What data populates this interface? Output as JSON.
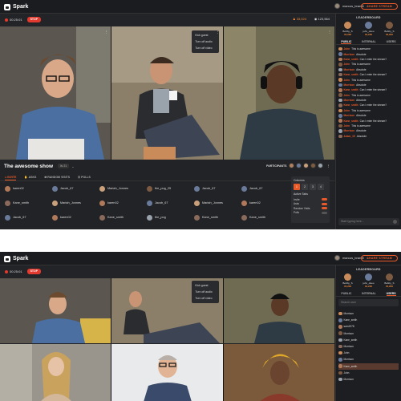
{
  "app": {
    "name": "Spark"
  },
  "topbar": {
    "username": "marcus_brandt",
    "share_label": "SHARE STREAM"
  },
  "subbar": {
    "timer": "00:25:01",
    "stop_label": "STOP",
    "viewers_orange": "33,024",
    "viewers": "123,564"
  },
  "context_menu": {
    "items": [
      "Kick guest",
      "Turn off audio",
      "Turn off video"
    ]
  },
  "show": {
    "title": "The awesome show",
    "badge": "liv 21"
  },
  "participants_label": "PARTICIPANTS",
  "tabs": [
    "INVITE",
    "ASKS",
    "RANDOM VISITS",
    "POLLS"
  ],
  "guest_grid": [
    "karen02",
    "Jacob_67",
    "Mariah_Jonnes",
    "the_pug_25",
    "Jacob_67",
    "Jacob_67",
    "Kane_smith",
    "Mariah_Jonnes",
    "karen02",
    "Jacob_67",
    "Mariah_Jonnes",
    "karen02",
    "Jacob_67",
    "karen02",
    "Kane_smith",
    "the_pog",
    "Kane_smith",
    "Kane_smith"
  ],
  "layout_popup": {
    "columns_label": "Columns",
    "columns": [
      "1",
      "2",
      "3",
      "4"
    ],
    "selected": "1",
    "active_tabs_label": "Active Tabs",
    "options": [
      {
        "label": "Invite",
        "on": true
      },
      {
        "label": "Asks",
        "on": true
      },
      {
        "label": "Random Visits",
        "on": true
      },
      {
        "label": "Polls",
        "on": false
      }
    ]
  },
  "sidebar": {
    "leaderboard_title": "LEADERBOARD",
    "leaders": [
      {
        "name": "Bobby_S",
        "value": "45,200"
      },
      {
        "name": "john_doeo",
        "value": "34,200"
      },
      {
        "name": "Bobby_S",
        "value": "45,200"
      }
    ],
    "tabs": [
      "PUBLIC",
      "INTERNAL",
      "USERS"
    ],
    "active_tab_p1": "PUBLIC",
    "active_tab_p2": "USERS",
    "chat": [
      {
        "user": "John",
        "text": "This is awesome"
      },
      {
        "user": "Morrison",
        "text": "Absolute"
      },
      {
        "user": "Kane_smith",
        "text": "Can I enter the stream?"
      },
      {
        "user": "John",
        "text": "This is awesome"
      },
      {
        "user": "Morrison",
        "text": "Absolute"
      },
      {
        "user": "Kane_smith",
        "text": "Can I enter the stream?"
      },
      {
        "user": "John",
        "text": "This is awesome"
      },
      {
        "user": "Morrison",
        "text": "Absolute"
      },
      {
        "user": "Kane_smith",
        "text": "Can I enter the stream?"
      },
      {
        "user": "John",
        "text": "This is awesome"
      },
      {
        "user": "Morrison",
        "text": "Absolute"
      },
      {
        "user": "Kane_smith",
        "text": "Can I enter the stream?"
      },
      {
        "user": "John",
        "text": "This is awesome"
      },
      {
        "user": "Morrison",
        "text": "Absolute"
      },
      {
        "user": "Kane_smith",
        "text": "Can I enter the stream?"
      },
      {
        "user": "John",
        "text": "This is awesome"
      },
      {
        "user": "Morrison",
        "text": "Absolute"
      },
      {
        "user": "Adam_15",
        "text": "Absolute"
      }
    ],
    "chat_placeholder": "Start typing here...",
    "search_placeholder": "Search user",
    "users": [
      "Morrison",
      "Kane_smith",
      "sam1978",
      "Morrison",
      "Kane_smith",
      "Morrison",
      "John",
      "Morrison",
      "Kane_smith",
      "John",
      "Morrison"
    ],
    "highlight_user_index": 8
  },
  "colors": {
    "accent": "#e85a2a",
    "danger": "#e23a2e",
    "panel": "#222326"
  }
}
